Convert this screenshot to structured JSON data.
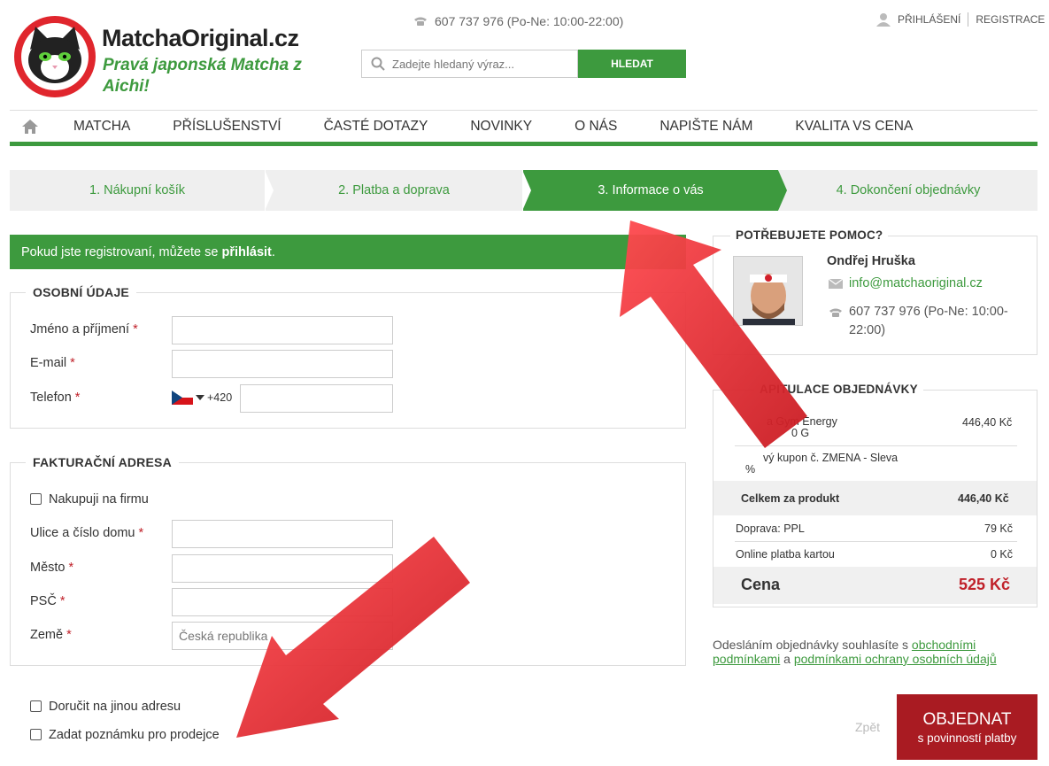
{
  "brand": {
    "name": "MatchaOriginal.cz",
    "tagline": "Pravá japonská Matcha z Aichi!"
  },
  "header": {
    "phone": "607 737 976 (Po-Ne: 10:00-22:00)",
    "login": "PŘIHLÁŠENÍ",
    "register": "REGISTRACE",
    "search_placeholder": "Zadejte hledaný výraz...",
    "search_button": "HLEDAT"
  },
  "nav": {
    "items": [
      "MATCHA",
      "PŘÍSLUŠENSTVÍ",
      "ČASTÉ DOTAZY",
      "NOVINKY",
      "O NÁS",
      "NAPIŠTE NÁM",
      "KVALITA VS CENA"
    ]
  },
  "steps": [
    {
      "label": "1. Nákupní košík",
      "active": false
    },
    {
      "label": "2. Platba a doprava",
      "active": false
    },
    {
      "label": "3. Informace o vás",
      "active": true
    },
    {
      "label": "4. Dokončení objednávky",
      "active": false
    }
  ],
  "login_notice": {
    "text": "Pokud jste registrovaní, můžete se ",
    "link": "přihlásit",
    "suffix": "."
  },
  "personal": {
    "title": "OSOBNÍ ÚDAJE",
    "name_label": "Jméno a příjmení",
    "email_label": "E-mail",
    "phone_label": "Telefon",
    "phone_prefix": "+420",
    "required_mark": "*"
  },
  "billing": {
    "title": "FAKTURAČNÍ ADRESA",
    "company_label": "Nakupuji na firmu",
    "street_label": "Ulice a číslo domu",
    "city_label": "Město",
    "zip_label": "PSČ",
    "country_label": "Země",
    "country_value": "Česká republika"
  },
  "options": {
    "other_address": "Doručit na jinou adresu",
    "note": "Zadat poznámku pro prodejce"
  },
  "help": {
    "title": "POTŘEBUJETE POMOC?",
    "name": "Ondřej Hruška",
    "email": "info@matchaoriginal.cz",
    "phone_line1": "607 737 976 (Po-Ne: 10:00-",
    "phone_line2": "22:00)"
  },
  "summary": {
    "title": "REKAPITULACE OBJEDNÁVKY",
    "title_visible": "APITULACE OBJEDNÁVKY",
    "item_line1": "a Gym Energy",
    "item_line2": "0 G",
    "item_price": "446,40 Kč",
    "coupon_line1": "vý kupon č. ZMENA - Sleva",
    "coupon_line2": "%",
    "product_total_label": "Celkem za produkt",
    "product_total_value": "446,40 Kč",
    "shipping_label": "Doprava: PPL",
    "shipping_value": "79 Kč",
    "payment_label": "Online platba kartou",
    "payment_value": "0 Kč",
    "total_label": "Cena",
    "total_value": "525 Kč"
  },
  "terms": {
    "prefix": "Odesláním objednávky souhlasíte s ",
    "link1_a": "obchodními",
    "link1_b": "podmínkami",
    "middle": " a ",
    "link2": "podmínkami ochrany osobních údajů"
  },
  "actions": {
    "back": "Zpět",
    "order": "OBJEDNAT",
    "order_sub": "s povinností platby"
  },
  "colors": {
    "green": "#3d9a3e",
    "red": "#a91b22",
    "arrow_red": "#e0262d"
  }
}
